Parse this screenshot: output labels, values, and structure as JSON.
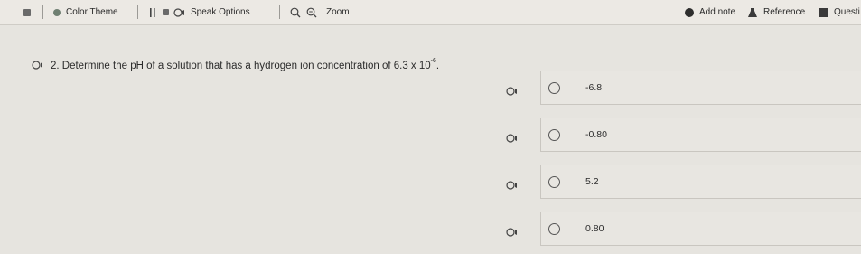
{
  "toolbar": {
    "color_theme_label": "Color Theme",
    "speak_options_label": "Speak Options",
    "zoom_label": "Zoom",
    "add_note_label": "Add note",
    "reference_label": "Reference",
    "question_label": "Questi",
    "add_note_color": "#2d2d2d",
    "color_theme_dot_color": "#6f7f72"
  },
  "question": {
    "number_text": "2. Determine the pH of a solution that has a hydrogen ion concentration of 6.3 x 10",
    "exponent": "-6",
    "trailing": "."
  },
  "choices": [
    {
      "label": "-6.8"
    },
    {
      "label": "-0.80"
    },
    {
      "label": "5.2"
    },
    {
      "label": "0.80"
    }
  ],
  "icons": {
    "speaker": "speaker-icon",
    "radio": "radio-circle-icon"
  }
}
